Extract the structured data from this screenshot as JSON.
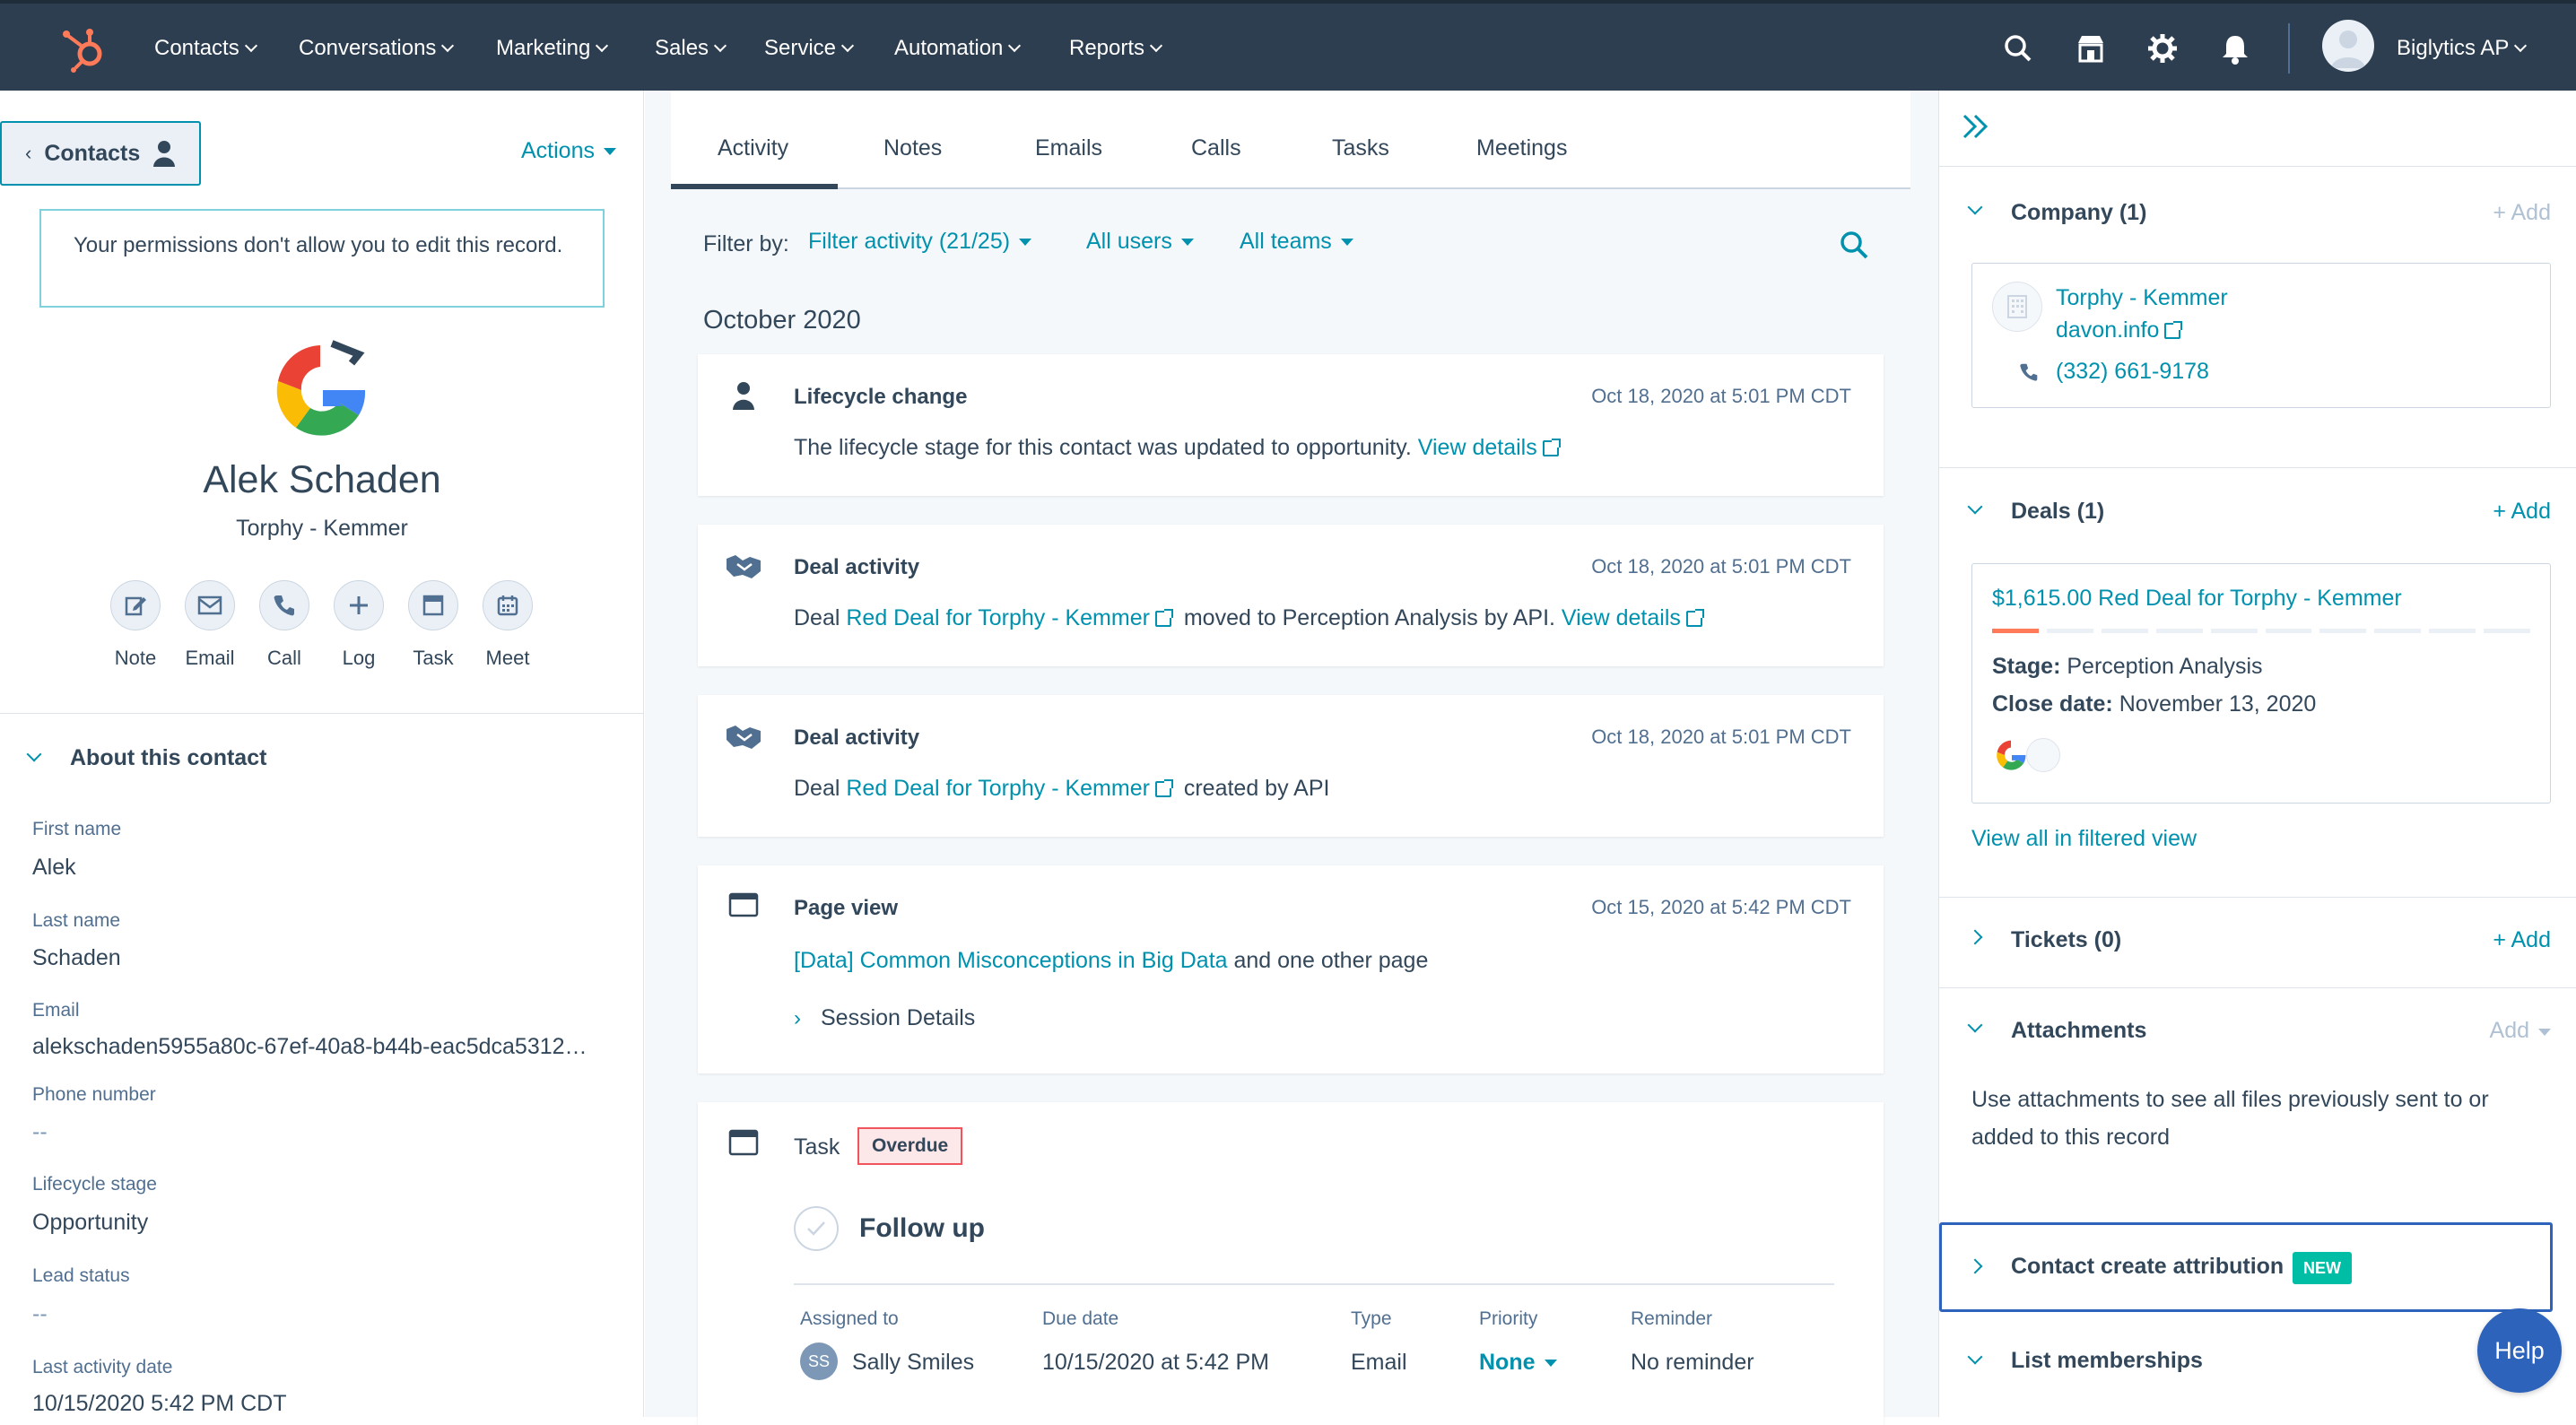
{
  "nav": {
    "items": [
      "Contacts",
      "Conversations",
      "Marketing",
      "Sales",
      "Service",
      "Automation",
      "Reports"
    ],
    "account_name": "Biglytics AP"
  },
  "left": {
    "back_label": "Contacts",
    "actions_label": "Actions",
    "permission_notice": "Your permissions don't allow you to edit this record.",
    "contact_name": "Alek Schaden",
    "company": "Torphy - Kemmer",
    "action_buttons": [
      "Note",
      "Email",
      "Call",
      "Log",
      "Task",
      "Meet"
    ],
    "about_title": "About this contact",
    "fields": [
      {
        "label": "First name",
        "value": "Alek"
      },
      {
        "label": "Last name",
        "value": "Schaden"
      },
      {
        "label": "Email",
        "value": "alekschaden5955a80c-67ef-40a8-b44b-eac5dca5312…"
      },
      {
        "label": "Phone number",
        "value": "--"
      },
      {
        "label": "Lifecycle stage",
        "value": "Opportunity"
      },
      {
        "label": "Lead status",
        "value": "--"
      },
      {
        "label": "Last activity date",
        "value": "10/15/2020 5:42 PM CDT"
      }
    ]
  },
  "mid": {
    "tabs": [
      "Activity",
      "Notes",
      "Emails",
      "Calls",
      "Tasks",
      "Meetings"
    ],
    "filter_by": "Filter by:",
    "filter_activity": "Filter activity (21/25)",
    "all_users": "All users",
    "all_teams": "All teams",
    "month": "October 2020",
    "cards": {
      "lifecycle": {
        "title": "Lifecycle change",
        "date": "Oct 18, 2020 at 5:01 PM CDT",
        "text": "The lifecycle stage for this contact was updated to opportunity.",
        "link": "View details"
      },
      "deal1": {
        "title": "Deal activity",
        "date": "Oct 18, 2020 at 5:01 PM CDT",
        "pre": "Deal",
        "deal": "Red Deal for Torphy - Kemmer",
        "mid": "moved to Perception Analysis by API.",
        "link": "View details"
      },
      "deal2": {
        "title": "Deal activity",
        "date": "Oct 18, 2020 at 5:01 PM CDT",
        "pre": "Deal",
        "deal": "Red Deal for Torphy - Kemmer",
        "mid": "created by API"
      },
      "pageview": {
        "title": "Page view",
        "date": "Oct 15, 2020 at 5:42 PM CDT",
        "page": "[Data] Common Misconceptions in Big Data",
        "rest": "and one other page",
        "session": "Session Details"
      },
      "task": {
        "title": "Task",
        "badge": "Overdue",
        "name": "Follow up",
        "columns": [
          "Assigned to",
          "Due date",
          "Type",
          "Priority",
          "Reminder"
        ],
        "assignee_initials": "SS",
        "assignee": "Sally Smiles",
        "due": "10/15/2020 at 5:42 PM",
        "type": "Email",
        "priority": "None",
        "reminder": "No reminder"
      }
    }
  },
  "right": {
    "company": {
      "title": "Company (1)",
      "add": "+ Add",
      "name": "Torphy - Kemmer",
      "domain": "davon.info",
      "phone": "(332) 661-9178"
    },
    "deals": {
      "title": "Deals (1)",
      "add": "+ Add",
      "deal_title": "$1,615.00 Red Deal for Torphy - Kemmer",
      "stage_label": "Stage:",
      "stage": "Perception Analysis",
      "close_label": "Close date:",
      "close": "November 13, 2020",
      "view_all": "View all in filtered view",
      "progress_segments": 10,
      "progress_filled": 1
    },
    "tickets": {
      "title": "Tickets (0)",
      "add": "+ Add"
    },
    "attachments": {
      "title": "Attachments",
      "add": "Add",
      "text": "Use attachments to see all files previously sent to or added to this record"
    },
    "attribution": {
      "title": "Contact create attribution",
      "badge": "NEW"
    },
    "lists": {
      "title": "List memberships"
    },
    "help_label": "Help"
  },
  "colors": {
    "nav_bg": "#2d3e50",
    "accent": "#0091ae",
    "hubspot_orange": "#ff7a59",
    "overdue": "#f2545b",
    "new_badge": "#00bda5"
  }
}
